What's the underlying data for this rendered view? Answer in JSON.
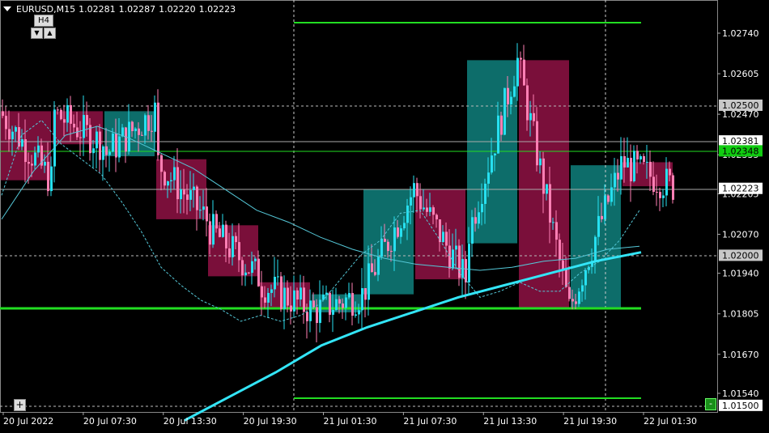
{
  "header": {
    "symbol": "EURUSD,M15",
    "open": "1.02281",
    "high": "1.02287",
    "low": "1.02220",
    "close": "1.02223"
  },
  "timeframe": {
    "label": "H4",
    "down_icon": "triangle-down-icon",
    "up_icon": "triangle-up-icon"
  },
  "buttons": {
    "plus": "+",
    "minus": "-"
  },
  "colors": {
    "background": "#000000",
    "bull_candle": "#27e0f0",
    "bear_candle": "#ff7fb4",
    "bull_box": "#0d6d6a",
    "bear_box": "#7a0f3a",
    "level_line": "#22dd22",
    "ma_thick": "#33e5f7",
    "price_label_bg": "#ffffff",
    "active_label_bg": "#11cc11"
  },
  "chart_data": {
    "type": "candlestick",
    "price_axis": [
      "1.02740",
      "1.02605",
      "1.02470",
      "1.02335",
      "1.02205",
      "1.02070",
      "1.01940",
      "1.01805",
      "1.01670",
      "1.01540"
    ],
    "price_labels": [
      {
        "value": "1.02500",
        "style": "grey"
      },
      {
        "value": "1.02381",
        "style": "white"
      },
      {
        "value": "1.02348",
        "style": "green"
      },
      {
        "value": "1.02223",
        "style": "white"
      },
      {
        "value": "1.02000",
        "style": "grey"
      },
      {
        "value": "1.01500",
        "style": "white"
      }
    ],
    "time_axis": [
      "20 Jul 2022",
      "20 Jul 07:30",
      "20 Jul 13:30",
      "20 Jul 19:30",
      "21 Jul 01:30",
      "21 Jul 07:30",
      "21 Jul 13:30",
      "21 Jul 19:30",
      "22 Jul 01:30"
    ],
    "levels": {
      "upper": 1.0276,
      "middle": 1.0183,
      "lower": 1.0153
    },
    "h4_boxes": [
      {
        "o": 1.0248,
        "c": 1.0225
      },
      {
        "o": 1.0248,
        "c": 1.0237
      },
      {
        "o": 1.0233,
        "c": 1.0248
      },
      {
        "o": 1.0232,
        "c": 1.0212
      },
      {
        "o": 1.021,
        "c": 1.0193
      },
      {
        "o": 1.0191,
        "c": 1.0182
      },
      {
        "o": 1.0181,
        "c": 1.0187
      },
      {
        "o": 1.0187,
        "c": 1.0222
      },
      {
        "o": 1.0222,
        "c": 1.0192
      },
      {
        "o": 1.0204,
        "c": 1.0265
      },
      {
        "o": 1.0265,
        "c": 1.0182
      },
      {
        "o": 1.0182,
        "c": 1.023
      },
      {
        "o": 1.0231,
        "c": 1.0223
      }
    ],
    "ma_fast": [
      1.022,
      1.024,
      1.0245,
      1.0237,
      1.0232,
      1.0227,
      1.0218,
      1.0208,
      1.0196,
      1.019,
      1.0185,
      1.0182,
      1.0178,
      1.018,
      1.0178,
      1.018,
      1.0184,
      1.0192,
      1.02,
      1.0205,
      1.0214,
      1.0215,
      1.0205,
      1.0194,
      1.0186,
      1.0188,
      1.0191,
      1.0188,
      1.0188,
      1.0194,
      1.0198,
      1.0205,
      1.0215
    ],
    "ma_mid": [
      1.0212,
      1.0228,
      1.024,
      1.0243,
      1.0239,
      1.0234,
      1.0229,
      1.0222,
      1.0215,
      1.0211,
      1.0206,
      1.0202,
      1.0199,
      1.0197,
      1.0196,
      1.0195,
      1.0196,
      1.0198,
      1.0199,
      1.0202,
      1.0203
    ],
    "ma_slow": [
      1.0145,
      1.0153,
      1.0161,
      1.017,
      1.0176,
      1.0181,
      1.0186,
      1.019,
      1.0194,
      1.0198,
      1.0201
    ]
  }
}
